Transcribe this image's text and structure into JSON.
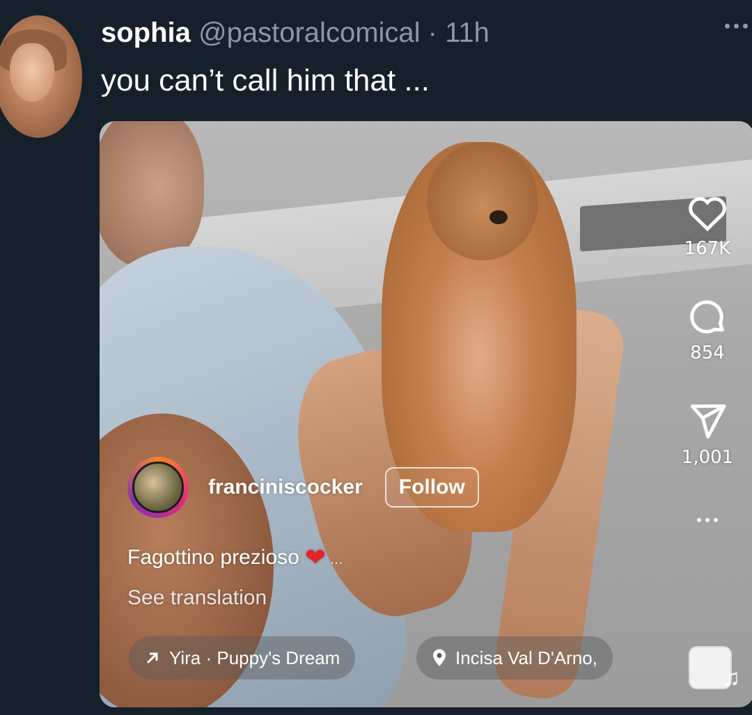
{
  "tweet": {
    "display_name": "sophia",
    "handle": "@pastoralcomical",
    "separator": "·",
    "time": "11h",
    "text": "you can’t call him that ...",
    "more_icon": "more-horizontal-icon"
  },
  "reel": {
    "owner": {
      "username": "franciniscocker",
      "follow_label": "Follow"
    },
    "caption": "Fagottino prezioso",
    "caption_heart": "❤",
    "caption_more": "...",
    "see_translation": "See translation",
    "actions": {
      "likes": "167K",
      "comments": "854",
      "shares": "1,001"
    },
    "audio": "Yira · Puppy's Dream",
    "location": "Incisa Val D'Arno,",
    "music_icon": "♫"
  },
  "colors": {
    "background": "#15202b",
    "secondary_text": "#8b98a5",
    "heart": "#e0242b"
  }
}
